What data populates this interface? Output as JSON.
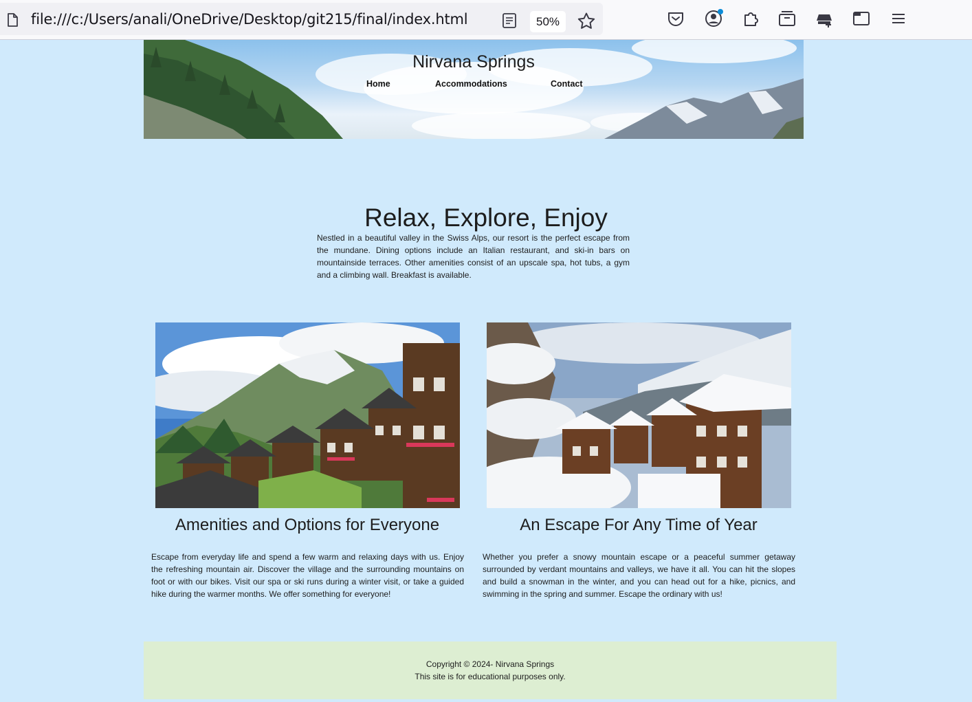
{
  "browser": {
    "url": "file:///c:/Users/anali/OneDrive/Desktop/git215/final/index.html",
    "zoom": "50%",
    "icons": [
      "page-icon",
      "reader-view-icon",
      "bookmark-star-icon",
      "pocket-icon",
      "account-icon",
      "extensions-icon",
      "tab-tray-icon",
      "private-browsing-icon",
      "container-icon",
      "menu-icon"
    ]
  },
  "site": {
    "title": "Nirvana Springs",
    "nav": [
      "Home",
      "Accommodations",
      "Contact"
    ]
  },
  "hero": {
    "title": "Relax, Explore, Enjoy",
    "text": "Nestled in a beautiful valley in the Swiss Alps, our resort is the perfect escape from the mundane. Dining options include an Italian restaurant, and ski-in bars on mountainside terraces. Other amenities consist of an upscale spa, hot tubs, a gym and a climbing wall. Breakfast is available."
  },
  "cards": [
    {
      "title": "Amenities and Options for Everyone",
      "text": "Escape from everyday life and spend a few warm and relaxing days with us. Enjoy the refreshing mountain air. Discover the village and the surrounding mountains on foot or with our bikes. Visit our spa or ski runs during a winter visit, or take a guided hike during the warmer months. We offer something for everyone!"
    },
    {
      "title": "An Escape For Any Time of Year",
      "text": "Whether you prefer a snowy mountain escape or a peaceful summer getaway surrounded by verdant mountains and valleys, we have it all. You can hit the slopes and build a snowman in the winter, and you can head out for a hike, picnics, and swimming in the spring and summer. Escape the ordinary with us!"
    }
  ],
  "footer": {
    "line1": "Copyright © 2024- Nirvana Springs",
    "line2": "This site is for educational purposes only."
  },
  "colors": {
    "page_background": "#d0eafc",
    "footer_background": "#ddeed2"
  }
}
